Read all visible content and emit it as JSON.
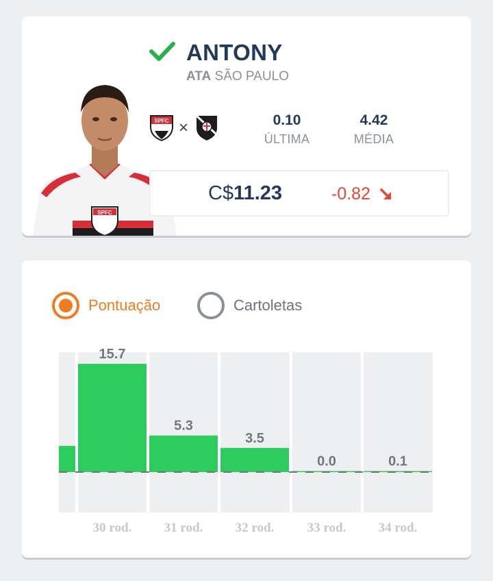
{
  "player": {
    "name": "ANTONY",
    "position": "ATA",
    "club": "SÃO PAULO",
    "status_icon": "check-icon",
    "status_color": "#27b14b",
    "home_club_badge_text": "SPFC",
    "vs_symbol": "×",
    "stats": {
      "last_value": "0.10",
      "last_label": "ÚLTIMA",
      "avg_value": "4.42",
      "avg_label": "MÉDIA"
    },
    "price_prefix": "C$",
    "price_value": "11.23",
    "variation": "-0.82",
    "variation_icon": "arrow-down-right-icon",
    "variation_color": "#e8472f"
  },
  "chart_toggle": {
    "options": [
      "Pontuação",
      "Cartoletas"
    ],
    "selected": "Pontuação",
    "accent_color": "#f17c20"
  },
  "chart_data": {
    "type": "bar",
    "categories": [
      "30 rod.",
      "31 rod.",
      "32 rod.",
      "33 rod.",
      "34 rod."
    ],
    "values": [
      15.7,
      5.3,
      3.5,
      0.0,
      0.1
    ],
    "value_labels": [
      "15.7",
      "5.3",
      "3.5",
      "0.0",
      "0.1"
    ],
    "partial_previous_value": 3.8,
    "bar_color": "#2ecc5f",
    "ylim": [
      -6,
      17.5
    ],
    "grid": false,
    "xlabel": "",
    "ylabel": ""
  }
}
